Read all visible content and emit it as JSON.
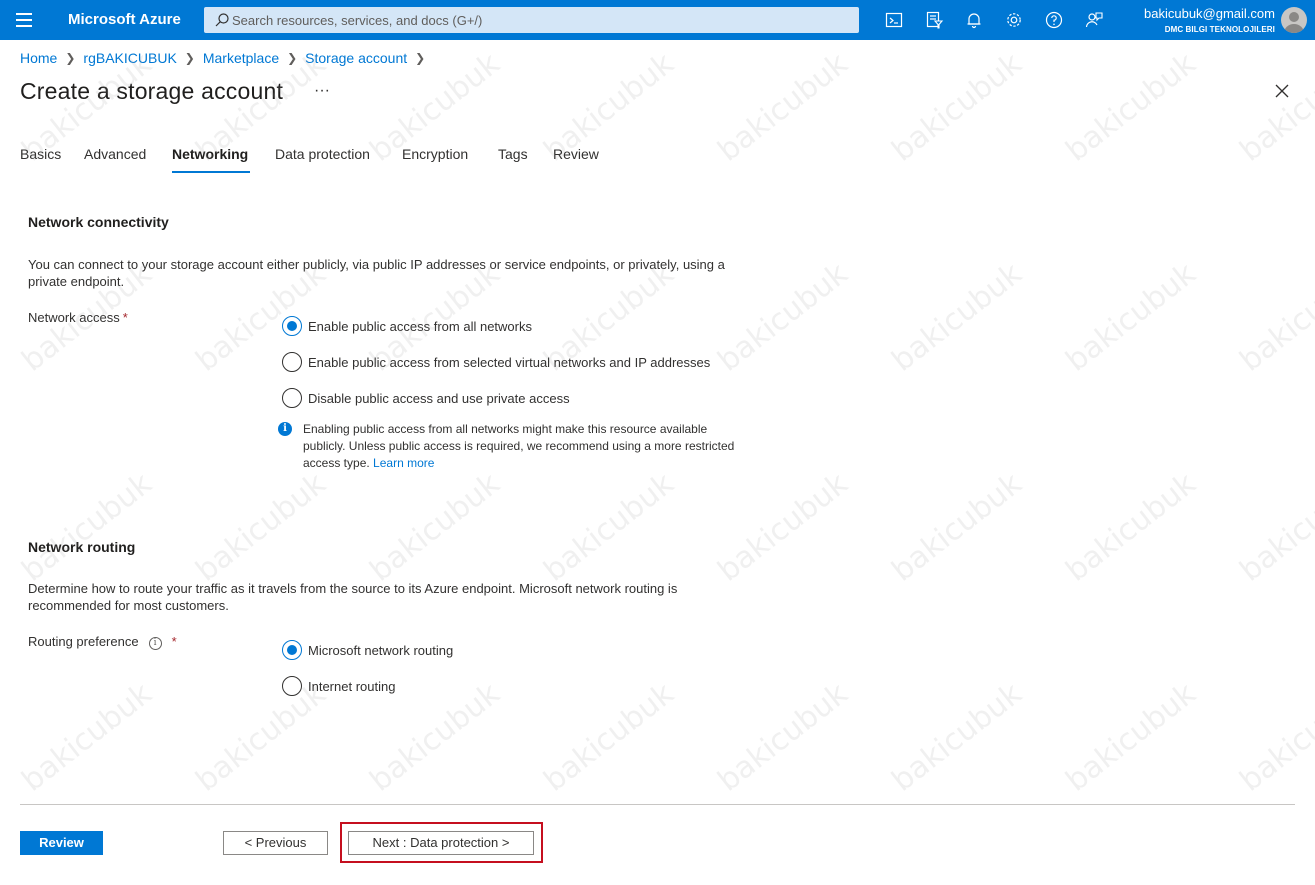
{
  "topbar": {
    "brand": "Microsoft Azure",
    "search_placeholder": "Search resources, services, and docs (G+/)",
    "user_email": "bakicubuk@gmail.com",
    "user_org": "DMC BILGI TEKNOLOJILERI",
    "icons": [
      "cloud-shell-icon",
      "directory-filter-icon",
      "notifications-icon",
      "settings-icon",
      "help-icon",
      "feedback-icon"
    ]
  },
  "breadcrumb": [
    "Home",
    "rgBAKICUBUK",
    "Marketplace",
    "Storage account"
  ],
  "page": {
    "title": "Create a storage account",
    "more": "···"
  },
  "tabs": [
    "Basics",
    "Advanced",
    "Networking",
    "Data protection",
    "Encryption",
    "Tags",
    "Review"
  ],
  "active_tab": "Networking",
  "connectivity": {
    "title": "Network connectivity",
    "description": "You can connect to your storage account either publicly, via public IP addresses or service endpoints, or privately, using a private endpoint.",
    "field_label": "Network access",
    "required_mark": "*",
    "options": [
      "Enable public access from all networks",
      "Enable public access from selected virtual networks and IP addresses",
      "Disable public access and use private access"
    ],
    "selected": "Enable public access from all networks",
    "info_text": "Enabling public access from all networks might make this resource available publicly. Unless public access is required, we recommend using a more restricted access type.",
    "info_link": "Learn more"
  },
  "routing": {
    "title": "Network routing",
    "description": "Determine how to route your traffic as it travels from the source to its Azure endpoint. Microsoft network routing is recommended for most customers.",
    "field_label": "Routing preference",
    "required_mark": "*",
    "options": [
      "Microsoft network routing",
      "Internet routing"
    ],
    "selected": "Microsoft network routing"
  },
  "footer": {
    "review": "Review",
    "previous": "< Previous",
    "next": "Next : Data protection >"
  },
  "watermark_text": "bakicubuk",
  "colors": {
    "accent": "#0078d4",
    "highlight": "#c50f1f"
  }
}
